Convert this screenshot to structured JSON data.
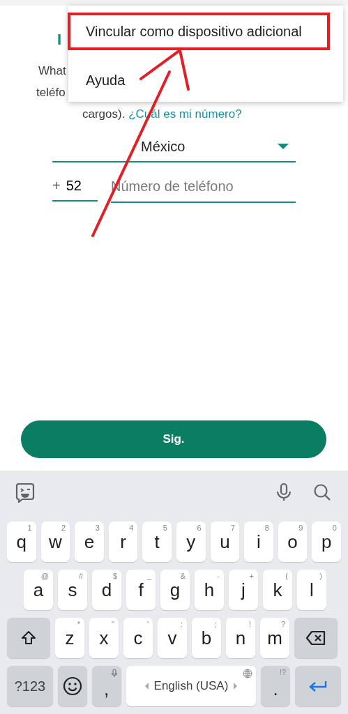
{
  "header": {
    "title": "I"
  },
  "intro": {
    "line_1": "What",
    "line_2": "teléfo",
    "line_3": "cargos).",
    "link": "¿Cuál es mi número?"
  },
  "country": {
    "value": "México"
  },
  "phone": {
    "prefix": "+",
    "code": "52",
    "placeholder": "Número de teléfono"
  },
  "next_button": "Sig.",
  "menu": {
    "items": [
      {
        "label": "Vincular como dispositivo adicional",
        "highlighted": true
      },
      {
        "label": "Ayuda",
        "highlighted": false
      }
    ]
  },
  "keyboard": {
    "rows": [
      [
        {
          "kind": "char",
          "label": "q",
          "hint": "1"
        },
        {
          "kind": "char",
          "label": "w",
          "hint": "2"
        },
        {
          "kind": "char",
          "label": "e",
          "hint": "3"
        },
        {
          "kind": "char",
          "label": "r",
          "hint": "4"
        },
        {
          "kind": "char",
          "label": "t",
          "hint": "5"
        },
        {
          "kind": "char",
          "label": "y",
          "hint": "6"
        },
        {
          "kind": "char",
          "label": "u",
          "hint": "7"
        },
        {
          "kind": "char",
          "label": "i",
          "hint": "8"
        },
        {
          "kind": "char",
          "label": "o",
          "hint": "9"
        },
        {
          "kind": "char",
          "label": "p",
          "hint": "0"
        }
      ],
      [
        {
          "kind": "char",
          "label": "a",
          "hint": "@"
        },
        {
          "kind": "char",
          "label": "s",
          "hint": "#"
        },
        {
          "kind": "char",
          "label": "d",
          "hint": "$"
        },
        {
          "kind": "char",
          "label": "f",
          "hint": "_"
        },
        {
          "kind": "char",
          "label": "g",
          "hint": "&"
        },
        {
          "kind": "char",
          "label": "h",
          "hint": "-"
        },
        {
          "kind": "char",
          "label": "j",
          "hint": "+"
        },
        {
          "kind": "char",
          "label": "k",
          "hint": "("
        },
        {
          "kind": "char",
          "label": "l",
          "hint": ")"
        }
      ],
      [
        {
          "kind": "shift"
        },
        {
          "kind": "char",
          "label": "z",
          "hint": "*"
        },
        {
          "kind": "char",
          "label": "x",
          "hint": "\""
        },
        {
          "kind": "char",
          "label": "c",
          "hint": "'"
        },
        {
          "kind": "char",
          "label": "v",
          "hint": ":"
        },
        {
          "kind": "char",
          "label": "b",
          "hint": ";"
        },
        {
          "kind": "char",
          "label": "n",
          "hint": "!"
        },
        {
          "kind": "char",
          "label": "m",
          "hint": "?"
        },
        {
          "kind": "backspace"
        }
      ]
    ],
    "bottom_row": [
      {
        "kind": "symbols",
        "label": "?123"
      },
      {
        "kind": "emoji"
      },
      {
        "kind": "comma",
        "label": ","
      },
      {
        "kind": "space",
        "label": "English (USA)"
      },
      {
        "kind": "period",
        "label": ".",
        "hint": "!?"
      },
      {
        "kind": "enter"
      }
    ]
  }
}
